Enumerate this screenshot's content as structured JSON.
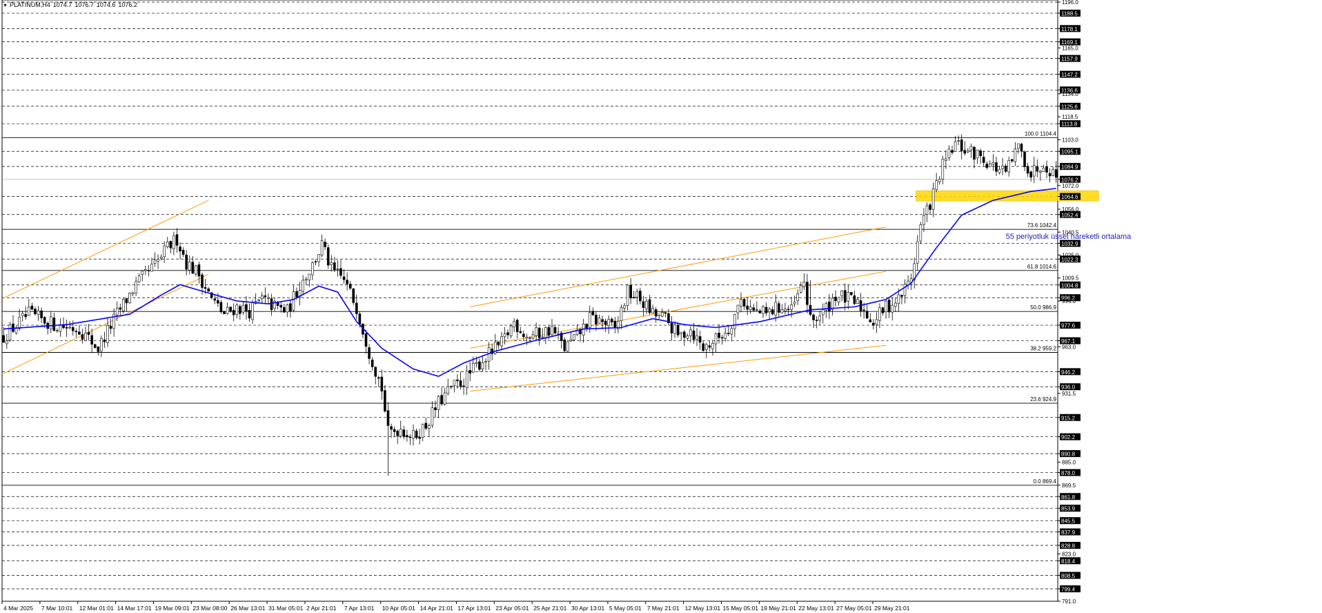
{
  "header": {
    "symbol": "PLATINUM,H4",
    "open": "1074.7",
    "high": "1076.7",
    "low": "1074.6",
    "close": "1076.2"
  },
  "colors": {
    "background": "#ffffff",
    "candle": "#000000",
    "ema": "#0000ff",
    "channel": "#ff9900",
    "zone": "#ffd700",
    "annotation": "#1c1cc8"
  },
  "annotation_text": "55 periyotluk üssel hareketli ortalama",
  "chart_data": {
    "type": "candlestick",
    "symbol": "PLATINUM",
    "timeframe": "H4",
    "ylim": [
      791.0,
      1196.0
    ],
    "x_ticks": [
      "4 Mar 2025",
      "7 Mar 10:01",
      "12 Mar 01:01",
      "14 Mar 17:01",
      "19 Mar 09:01",
      "23 Mar 08:00",
      "26 Mar 13:01",
      "31 Mar 05:01",
      "2 Apr 21:01",
      "7 Apr 13:01",
      "10 Apr 05:01",
      "14 Apr 21:01",
      "17 Apr 13:01",
      "23 Apr 05:01",
      "25 Apr 21:01",
      "30 Apr 13:01",
      "5 May 05:01",
      "7 May 21:01",
      "12 May 13:01",
      "15 May 05:01",
      "19 May 21:01",
      "22 May 13:01",
      "27 May 05:01",
      "29 May 21:01"
    ],
    "y_ticks": [
      "1196.0",
      "1188.5",
      "1178.1",
      "1169.1",
      "1165.0",
      "1157.9",
      "1147.2",
      "1136.6",
      "1134.0",
      "1125.6",
      "1118.5",
      "1113.8",
      "1103.0",
      "1095.1",
      "1084.9",
      "1076.2",
      "1072.0",
      "1064.6",
      "1056.0",
      "1052.4",
      "1040.5",
      "1032.9",
      "1025.0",
      "1022.3",
      "1009.5",
      "1004.8",
      "996.2",
      "994.0",
      "977.6",
      "967.1",
      "963.0",
      "946.2",
      "936.0",
      "931.5",
      "915.2",
      "902.2",
      "890.8",
      "885.0",
      "878.0",
      "869.5",
      "861.8",
      "853.9",
      "845.5",
      "837.9",
      "828.8",
      "823.0",
      "818.4",
      "808.5",
      "799.4",
      "791.0"
    ],
    "highlighted_levels": [
      "1188.5",
      "1178.1",
      "1169.1",
      "1157.9",
      "1147.2",
      "1136.6",
      "1125.6",
      "1113.8",
      "1095.1",
      "1084.9",
      "1076.2",
      "1064.6",
      "1052.4",
      "1032.9",
      "1022.3",
      "1004.8",
      "996.2",
      "977.6",
      "967.1",
      "946.2",
      "936.0",
      "915.2",
      "902.2",
      "890.8",
      "878.0",
      "861.8",
      "853.9",
      "845.5",
      "837.9",
      "828.8",
      "818.4",
      "808.5",
      "799.4"
    ],
    "dashed_levels": [
      1196.0,
      1188.5,
      1178.1,
      1169.1,
      1157.9,
      1147.2,
      1136.6,
      1125.6,
      1113.8,
      1095.1,
      1084.9,
      1064.6,
      1052.4,
      1032.9,
      1022.3,
      1004.8,
      996.2,
      977.6,
      967.1,
      946.2,
      936.0,
      915.2,
      902.2,
      890.8,
      878.0,
      861.8,
      853.9,
      845.5,
      837.9,
      828.8,
      818.4,
      808.5,
      799.4
    ],
    "fibonacci": [
      {
        "label": "100.0 1104.4",
        "value": 1104.4
      },
      {
        "label": "73.6 1042.4",
        "value": 1042.4
      },
      {
        "label": "61.8 1014.6",
        "value": 1014.6
      },
      {
        "label": "50.0 986.9",
        "value": 986.9
      },
      {
        "label": "38.2 959.2",
        "value": 959.2
      },
      {
        "label": "23.6 924.9",
        "value": 924.9
      },
      {
        "label": "0.0 869.4",
        "value": 869.4
      }
    ],
    "price_path": [
      [
        0,
        970
      ],
      [
        8,
        985
      ],
      [
        16,
        978
      ],
      [
        24,
        975
      ],
      [
        30,
        962
      ],
      [
        36,
        985
      ],
      [
        42,
        1005
      ],
      [
        48,
        1018
      ],
      [
        52,
        1030
      ],
      [
        55,
        1036
      ],
      [
        58,
        1020
      ],
      [
        62,
        1012
      ],
      [
        66,
        995
      ],
      [
        70,
        985
      ],
      [
        74,
        990
      ],
      [
        78,
        987
      ],
      [
        82,
        995
      ],
      [
        86,
        990
      ],
      [
        90,
        987
      ],
      [
        94,
        1005
      ],
      [
        98,
        1018
      ],
      [
        101,
        1032
      ],
      [
        104,
        1015
      ],
      [
        108,
        1008
      ],
      [
        112,
        990
      ],
      [
        116,
        960
      ],
      [
        120,
        935
      ],
      [
        122,
        905
      ],
      [
        126,
        908
      ],
      [
        130,
        902
      ],
      [
        134,
        910
      ],
      [
        138,
        925
      ],
      [
        142,
        935
      ],
      [
        146,
        940
      ],
      [
        150,
        950
      ],
      [
        154,
        958
      ],
      [
        158,
        965
      ],
      [
        162,
        980
      ],
      [
        166,
        970
      ],
      [
        170,
        972
      ],
      [
        174,
        975
      ],
      [
        178,
        962
      ],
      [
        182,
        970
      ],
      [
        186,
        982
      ],
      [
        190,
        980
      ],
      [
        194,
        975
      ],
      [
        198,
        1000
      ],
      [
        202,
        995
      ],
      [
        206,
        985
      ],
      [
        210,
        982
      ],
      [
        214,
        970
      ],
      [
        218,
        975
      ],
      [
        222,
        962
      ],
      [
        226,
        968
      ],
      [
        230,
        975
      ],
      [
        234,
        995
      ],
      [
        238,
        987
      ],
      [
        242,
        985
      ],
      [
        246,
        990
      ],
      [
        250,
        987
      ],
      [
        254,
        1007
      ],
      [
        256,
        980
      ],
      [
        260,
        986
      ],
      [
        264,
        998
      ],
      [
        268,
        995
      ],
      [
        272,
        990
      ],
      [
        276,
        980
      ],
      [
        280,
        990
      ],
      [
        284,
        995
      ],
      [
        288,
        1010
      ],
      [
        291,
        1045
      ],
      [
        294,
        1060
      ],
      [
        298,
        1085
      ],
      [
        302,
        1100
      ],
      [
        306,
        1095
      ],
      [
        310,
        1092
      ],
      [
        314,
        1085
      ],
      [
        318,
        1080
      ],
      [
        322,
        1098
      ],
      [
        326,
        1080
      ],
      [
        330,
        1088
      ],
      [
        334,
        1078
      ]
    ],
    "ema55_path": [
      [
        0,
        975
      ],
      [
        20,
        978
      ],
      [
        40,
        985
      ],
      [
        50,
        998
      ],
      [
        56,
        1005
      ],
      [
        64,
        1000
      ],
      [
        74,
        994
      ],
      [
        84,
        992
      ],
      [
        92,
        995
      ],
      [
        100,
        1004
      ],
      [
        106,
        1000
      ],
      [
        112,
        980
      ],
      [
        120,
        962
      ],
      [
        130,
        948
      ],
      [
        138,
        943
      ],
      [
        146,
        952
      ],
      [
        156,
        960
      ],
      [
        170,
        968
      ],
      [
        184,
        975
      ],
      [
        196,
        976
      ],
      [
        206,
        982
      ],
      [
        216,
        978
      ],
      [
        226,
        976
      ],
      [
        240,
        980
      ],
      [
        256,
        988
      ],
      [
        270,
        990
      ],
      [
        280,
        995
      ],
      [
        288,
        1006
      ],
      [
        296,
        1030
      ],
      [
        304,
        1052
      ],
      [
        314,
        1062
      ],
      [
        326,
        1068
      ],
      [
        334,
        1070
      ]
    ],
    "ema_annotation_point": [
      318,
      1036
    ],
    "ema_annotation_label": "55 periyotluk üssel hareketli ortalama",
    "support_zone": {
      "from": 290,
      "to": 348,
      "low": 1061.5,
      "high": 1068.5
    },
    "channels": [
      {
        "x1": 0,
        "y1": 945,
        "x2": 65,
        "y2": 1012
      },
      {
        "x1": 0,
        "y1": 996,
        "x2": 65,
        "y2": 1062
      },
      {
        "x1": 148,
        "y1": 933,
        "x2": 280,
        "y2": 964
      },
      {
        "x1": 148,
        "y1": 962,
        "x2": 280,
        "y2": 1014
      },
      {
        "x1": 148,
        "y1": 990,
        "x2": 280,
        "y2": 1044
      }
    ],
    "current_price": 1076.2
  }
}
